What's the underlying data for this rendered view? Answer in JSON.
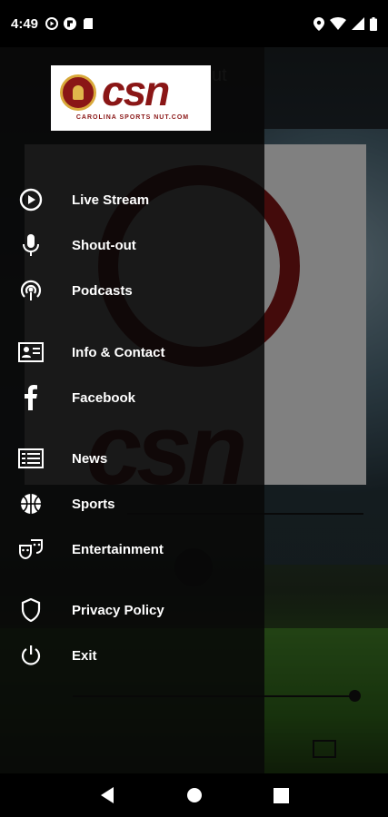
{
  "status_bar": {
    "time": "4:49",
    "left_icons": [
      "play-circle-icon",
      "flipboard-icon",
      "sd-card-icon"
    ],
    "right_icons": [
      "location-icon",
      "wifi-icon",
      "signal-icon",
      "battery-icon"
    ]
  },
  "background_app": {
    "title_fragment": "ut"
  },
  "drawer": {
    "logo": {
      "wordmark": "csn",
      "tagline": "CAROLINA SPORTS NUT.COM"
    },
    "items": [
      {
        "label": "Live Stream",
        "icon": "play-circle-icon"
      },
      {
        "label": "Shout-out",
        "icon": "microphone-icon"
      },
      {
        "label": "Podcasts",
        "icon": "podcast-icon"
      },
      {
        "label": "Info & Contact",
        "icon": "contact-card-icon"
      },
      {
        "label": "Facebook",
        "icon": "facebook-icon"
      },
      {
        "label": "News",
        "icon": "news-icon"
      },
      {
        "label": "Sports",
        "icon": "basketball-icon"
      },
      {
        "label": "Entertainment",
        "icon": "theater-masks-icon"
      },
      {
        "label": "Privacy Policy",
        "icon": "shield-icon"
      },
      {
        "label": "Exit",
        "icon": "power-icon"
      }
    ]
  },
  "nav_bar": {
    "buttons": [
      "back-button",
      "home-button",
      "recents-button"
    ]
  },
  "colors": {
    "brand": "#8a1616",
    "drawer_bg": "#080808",
    "text": "#ffffff"
  }
}
